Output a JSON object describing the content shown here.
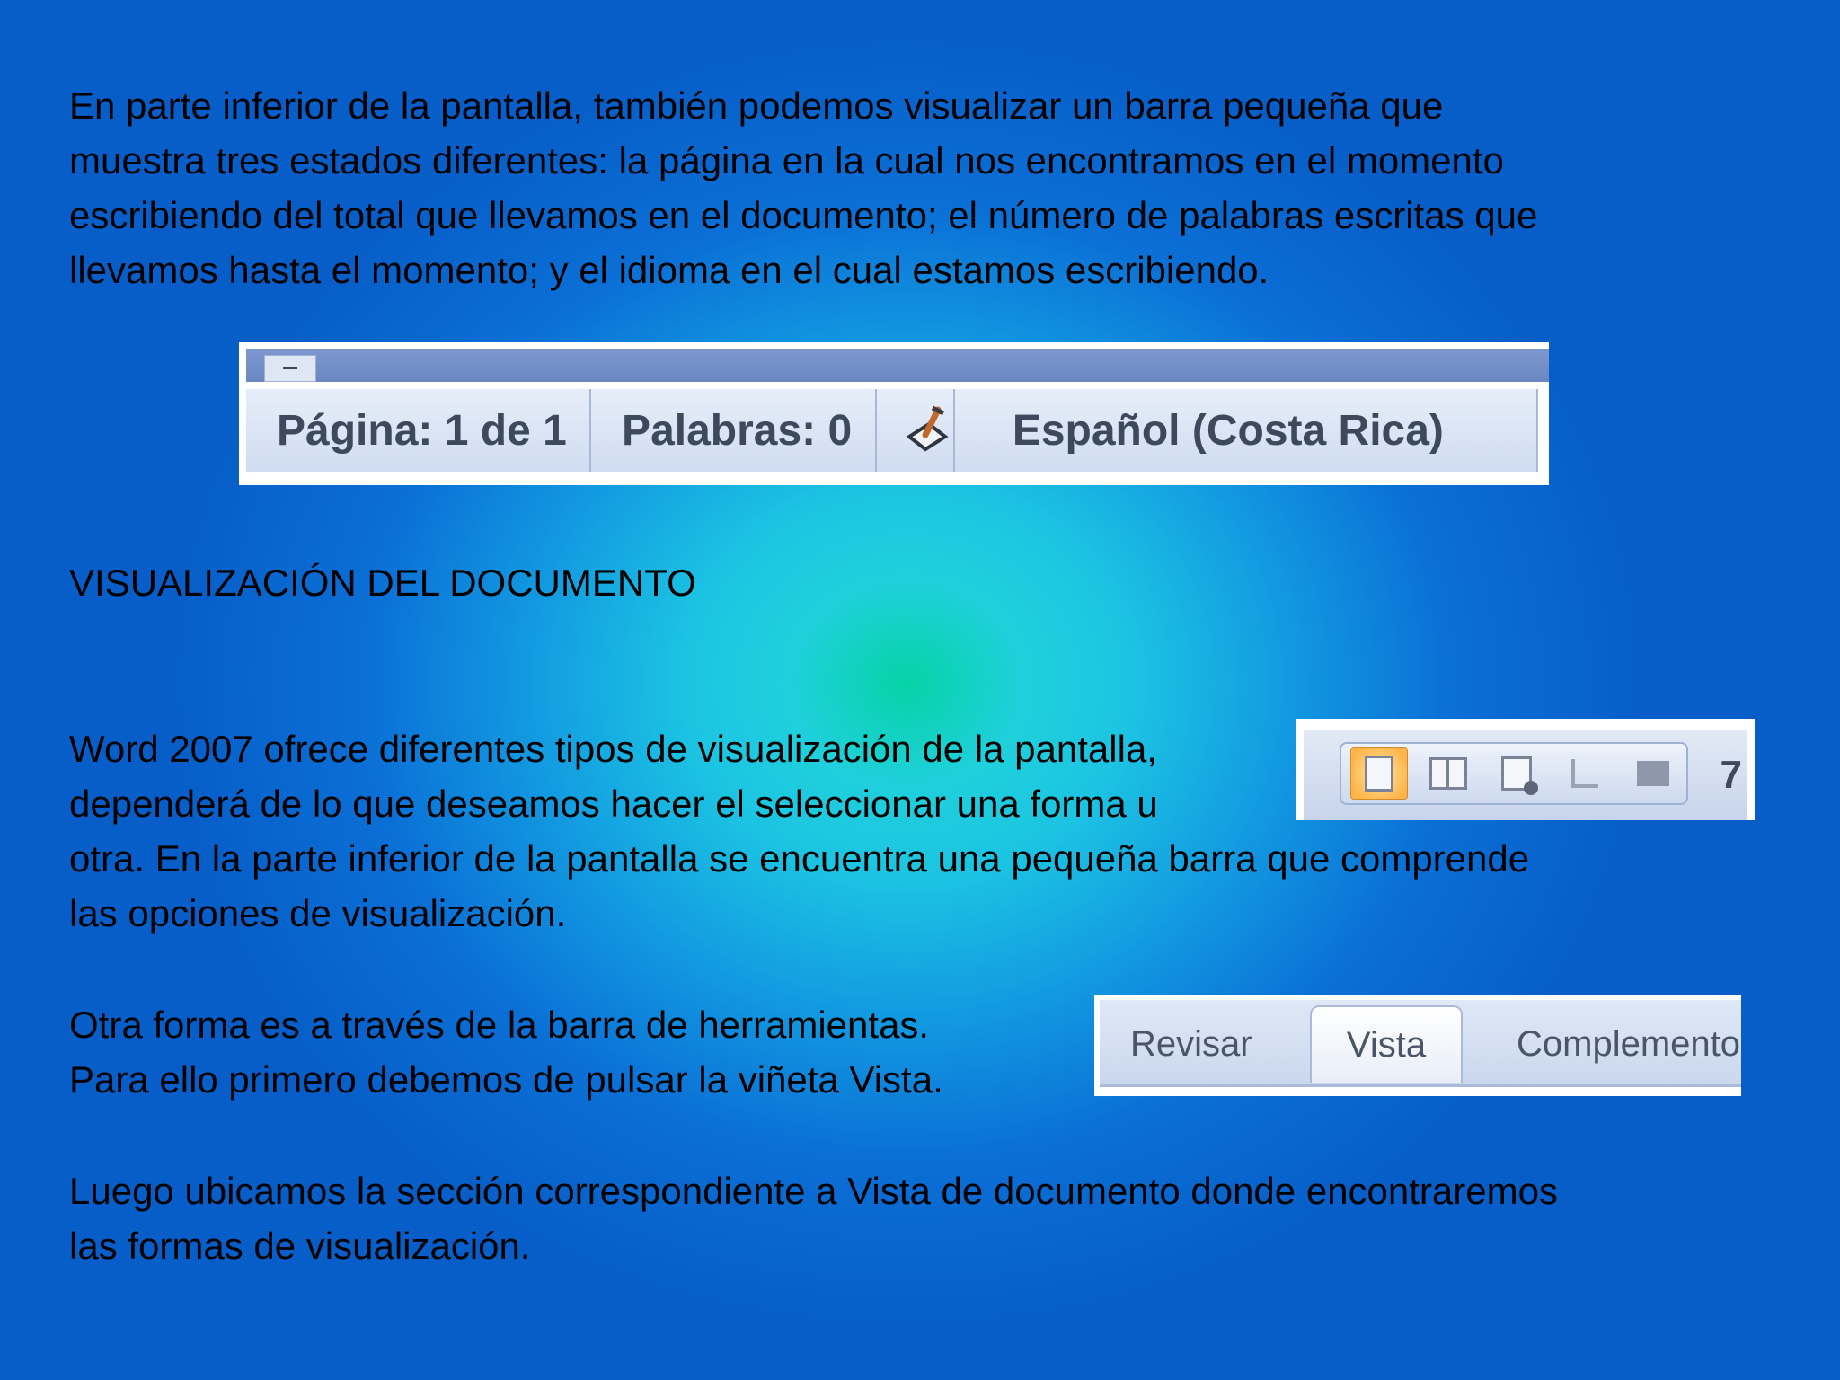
{
  "intro_paragraph": {
    "lines": [
      "En parte inferior de la pantalla, también podemos visualizar un barra pequeña que",
      "muestra tres estados diferentes: la página en la cual nos encontramos en el momento",
      "escribiendo del total que llevamos en el documento; el número de palabras escritas que",
      "llevamos hasta el momento; y el idioma en el cual estamos escribiendo."
    ]
  },
  "status_bar": {
    "page": "Página: 1 de 1",
    "words": "Palabras: 0",
    "spellcheck_icon": "spellcheck-icon",
    "language": "Español (Costa Rica)"
  },
  "section_title": "VISUALIZACIÓN DEL DOCUMENTO",
  "views_paragraph": {
    "lines": [
      "Word 2007 ofrece diferentes tipos de visualización de la pantalla,",
      "dependerá de lo que deseamos hacer el seleccionar una forma u",
      "otra. En la parte inferior de la pantalla se encuentra una pequeña barra que comprende",
      "las opciones de visualización."
    ]
  },
  "view_buttons": {
    "icons": [
      "print-layout-icon",
      "full-screen-reading-icon",
      "web-layout-icon",
      "outline-icon",
      "draft-icon"
    ],
    "zoom_digit": "7"
  },
  "toolbar_paragraph": {
    "lines": [
      "Otra forma es a través de la barra de herramientas.",
      "Para ello primero debemos de pulsar la viñeta Vista."
    ]
  },
  "ribbon_tabs": {
    "revisar": "Revisar",
    "vista": "Vista",
    "complementos": "Complemento"
  },
  "final_paragraph": {
    "lines": [
      "Luego ubicamos la sección correspondiente a Vista de documento donde encontraremos",
      "las formas de visualización."
    ]
  },
  "colors": {
    "background_center": "#06d3a6",
    "background_edge": "#075ec8",
    "text": "#000000"
  }
}
